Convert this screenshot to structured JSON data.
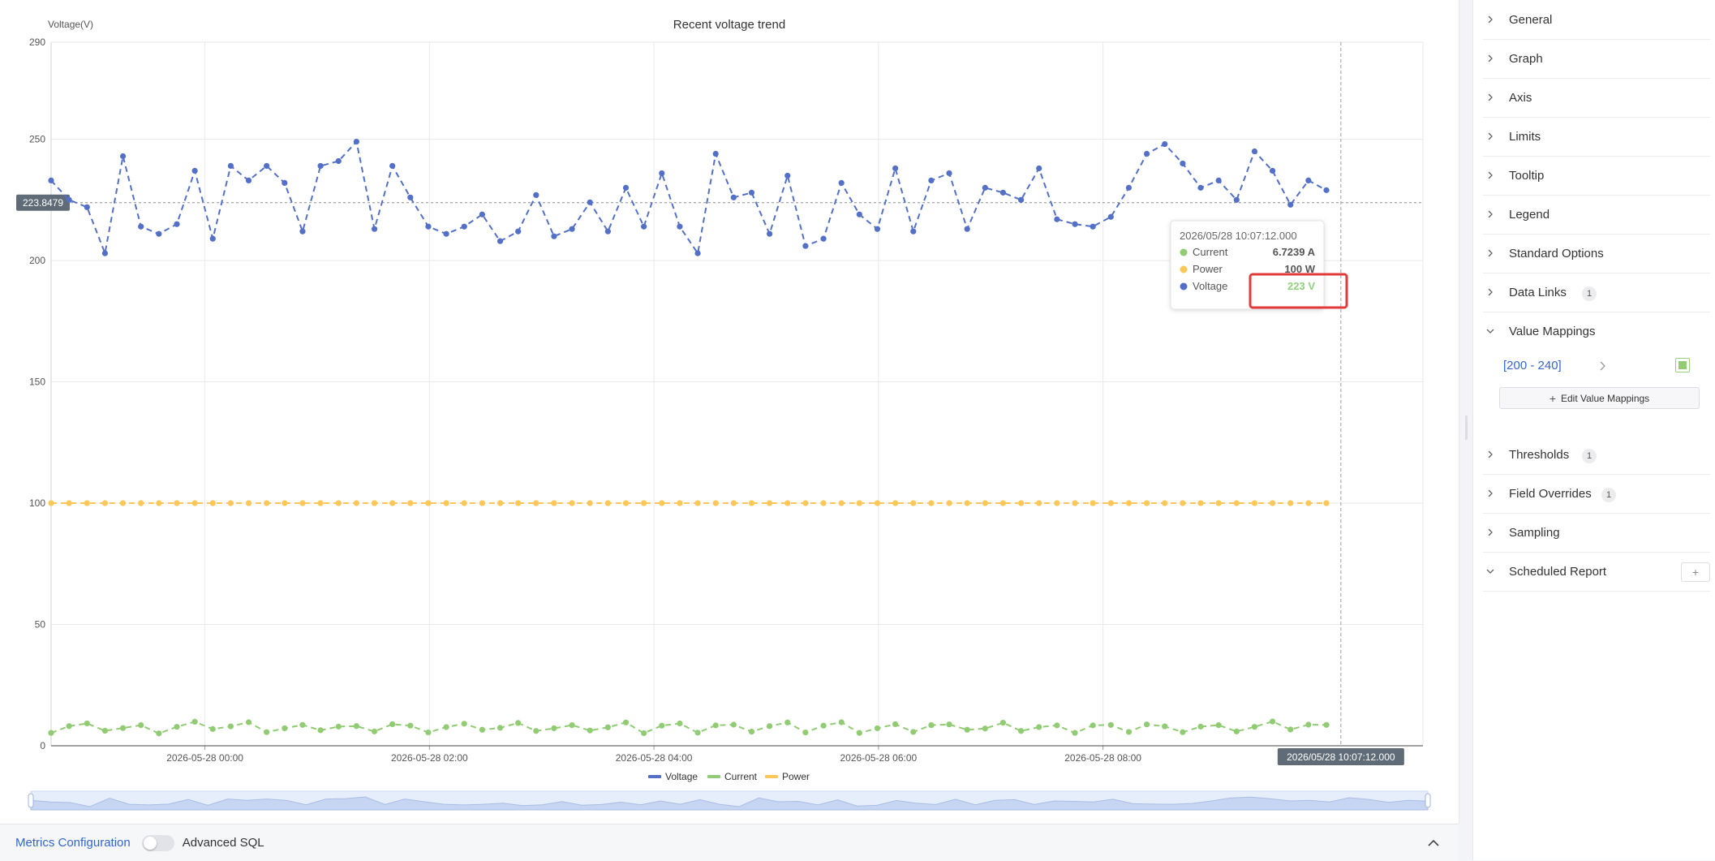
{
  "chart_data": {
    "type": "line",
    "title": "Recent voltage trend",
    "ylabel": "Voltage(V)",
    "ylim": [
      0,
      290
    ],
    "y_ticks": [
      "290",
      "250",
      "200",
      "150",
      "100",
      "50",
      "0"
    ],
    "x_ticks": [
      "2026-05-28 00:00",
      "2026-05-28 02:00",
      "2026-05-28 04:00",
      "2026-05-28 06:00",
      "2026-05-28 08:00"
    ],
    "x_tick_hours": [
      0,
      2,
      4,
      6,
      8
    ],
    "x_range_hours": [
      -1.37,
      10.85
    ],
    "x_start_hour": -1.37,
    "x_step_hours": 0.16,
    "reference_line": {
      "value": 223.8479,
      "label": "223.8479"
    },
    "crosshair": {
      "hour": 10.119,
      "label": "2026/05/28 10:07:12.000"
    },
    "series": [
      {
        "name": "Voltage",
        "color": "#5470c6",
        "values": [
          233,
          225,
          222,
          203,
          243,
          214,
          211,
          215,
          237,
          209,
          239,
          233,
          239,
          232,
          212,
          239,
          241,
          249,
          213,
          239,
          226,
          214,
          211,
          214,
          219,
          208,
          212,
          227,
          210,
          213,
          224,
          212,
          230,
          214,
          236,
          214,
          203,
          244,
          226,
          228,
          211,
          235,
          206,
          209,
          232,
          219,
          213,
          238,
          212,
          233,
          236,
          213,
          230,
          228,
          225,
          238,
          217,
          215,
          214,
          218,
          230,
          244,
          248,
          240,
          230,
          233,
          225,
          245,
          237,
          223,
          233,
          229
        ]
      },
      {
        "name": "Current",
        "color": "#91cc75",
        "values": [
          5.3,
          8.1,
          9.2,
          6.2,
          7.3,
          8.5,
          5.1,
          7.8,
          9.9,
          6.9,
          8.0,
          9.7,
          5.6,
          7.2,
          8.6,
          6.4,
          7.9,
          8.1,
          5.9,
          8.9,
          8.3,
          5.5,
          7.7,
          9.1,
          6.6,
          7.4,
          9.4,
          6.1,
          7.2,
          8.5,
          6.3,
          7.6,
          9.6,
          5.2,
          8.3,
          9.2,
          5.4,
          8.4,
          8.7,
          5.8,
          8.1,
          9.6,
          5.5,
          8.3,
          9.7,
          5.3,
          7.2,
          8.9,
          5.7,
          8.5,
          8.8,
          6.6,
          7.1,
          9.5,
          6.1,
          7.7,
          8.4,
          5.3,
          8.4,
          8.6,
          5.7,
          8.8,
          8.0,
          5.6,
          7.9,
          8.5,
          5.9,
          7.8,
          10.0,
          6.7,
          8.7,
          8.6
        ]
      },
      {
        "name": "Power",
        "color": "#fac858",
        "values": [
          100,
          100,
          100,
          100,
          100,
          100,
          100,
          100,
          100,
          100,
          100,
          100,
          100,
          100,
          100,
          100,
          100,
          100,
          100,
          100,
          100,
          100,
          100,
          100,
          100,
          100,
          100,
          100,
          100,
          100,
          100,
          100,
          100,
          100,
          100,
          100,
          100,
          100,
          100,
          100,
          100,
          100,
          100,
          100,
          100,
          100,
          100,
          100,
          100,
          100,
          100,
          100,
          100,
          100,
          100,
          100,
          100,
          100,
          100,
          100,
          100,
          100,
          100,
          100,
          100,
          100,
          100,
          100,
          100,
          100,
          100,
          100
        ]
      }
    ],
    "legend": {
      "position": "bottom",
      "items": [
        "Voltage",
        "Current",
        "Power"
      ]
    },
    "tooltip": {
      "title": "2026/05/28 10:07:12.000",
      "rows": [
        {
          "name": "Current",
          "value": "6.7239 A",
          "color": "#91cc75",
          "value_color": "#555555"
        },
        {
          "name": "Power",
          "value": "100 W",
          "color": "#fac858",
          "value_color": "#555555"
        },
        {
          "name": "Voltage",
          "value": "223 V",
          "color": "#5470c6",
          "value_color": "#8fd17a"
        }
      ]
    },
    "grid": true
  },
  "bottom_bar": {
    "metrics_label": "Metrics Configuration",
    "advanced_sql_label": "Advanced SQL"
  },
  "side_panel": {
    "sections": [
      {
        "title": "General"
      },
      {
        "title": "Graph"
      },
      {
        "title": "Axis"
      },
      {
        "title": "Limits"
      },
      {
        "title": "Tooltip"
      },
      {
        "title": "Legend"
      },
      {
        "title": "Standard Options"
      },
      {
        "title": "Data Links",
        "badge": "1"
      },
      {
        "title": "Value Mappings",
        "expanded": true
      },
      {
        "title": "Thresholds",
        "badge": "1"
      },
      {
        "title": "Field Overrides",
        "badge": "1"
      },
      {
        "title": "Sampling"
      },
      {
        "title": "Scheduled Report",
        "expanded": true
      }
    ],
    "value_mapping": {
      "range": "[200 - 240]",
      "swatch_color": "#91cc75"
    },
    "edit_mappings_label": "Edit Value Mappings"
  }
}
